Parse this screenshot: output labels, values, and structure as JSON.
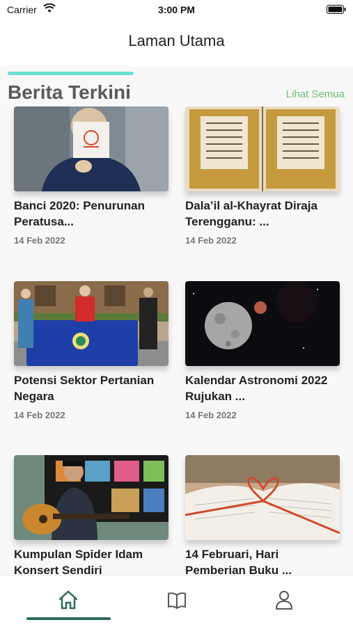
{
  "status_bar": {
    "carrier": "Carrier",
    "time": "3:00 PM"
  },
  "nav": {
    "title": "Laman Utama"
  },
  "section": {
    "title": "Berita Terkini",
    "see_all": "Lihat Semua"
  },
  "articles": [
    {
      "title": "Banci 2020: Penurunan Peratusa...",
      "date": "14 Feb 2022"
    },
    {
      "title": "Dala’il al-Khayrat Diraja Terengganu: ...",
      "date": "14 Feb 2022"
    },
    {
      "title": "Potensi Sektor Pertanian Negara",
      "date": "14 Feb 2022"
    },
    {
      "title": "Kalendar Astronomi 2022 Rujukan ...",
      "date": "14 Feb 2022"
    },
    {
      "title": "Kumpulan Spider Idam Konsert Sendiri",
      "date": ""
    },
    {
      "title": "14 Februari, Hari Pemberian Buku ...",
      "date": ""
    }
  ],
  "tabs": {
    "active": "home",
    "items": [
      "home-icon",
      "book-icon",
      "profile-icon"
    ]
  },
  "colors": {
    "accent": "#6de3cf",
    "link": "#6fbf73",
    "tab_active": "#2b6b5e"
  }
}
